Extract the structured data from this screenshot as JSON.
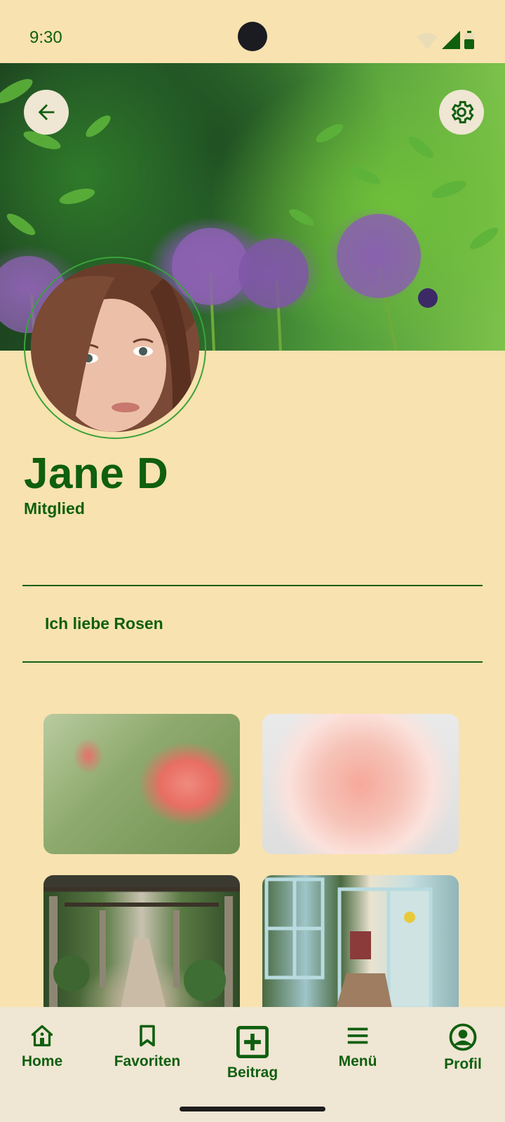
{
  "status_bar": {
    "time": "9:30"
  },
  "profile": {
    "name": "Jane D",
    "role": "Mitglied",
    "bio": "Ich liebe Rosen"
  },
  "nav": {
    "items": [
      {
        "label": "Home",
        "icon": "home-icon"
      },
      {
        "label": "Favoriten",
        "icon": "bookmark-icon"
      },
      {
        "label": "Beitrag",
        "icon": "add-post-icon"
      },
      {
        "label": "Menü",
        "icon": "menu-icon"
      },
      {
        "label": "Profil",
        "icon": "account-circle-icon"
      }
    ]
  },
  "colors": {
    "background": "#f8e2b0",
    "accent": "#0f5f0f",
    "nav_background": "#efe6d3",
    "avatar_ring": "#3aa33a"
  }
}
